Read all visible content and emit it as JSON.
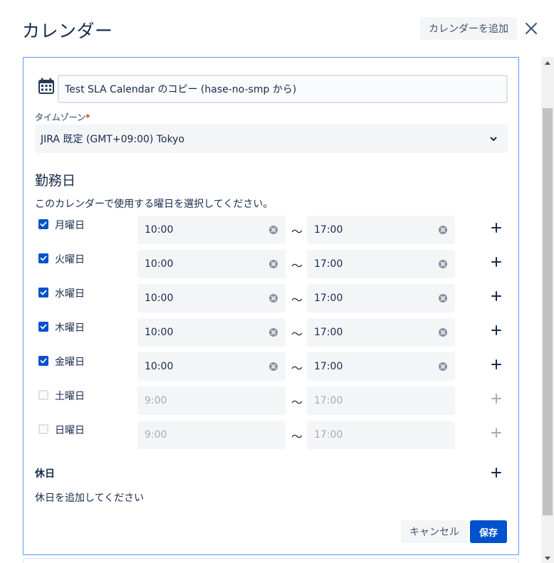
{
  "header": {
    "title": "カレンダー",
    "add_calendar_label": "カレンダーを追加",
    "close_icon": "close-icon"
  },
  "calendar": {
    "name": "Test SLA Calendar のコピー (hase-no-smp から)",
    "icon": "calendar-icon"
  },
  "timezone": {
    "label": "タイムゾーン",
    "required_mark": "*",
    "value": "JIRA 既定 (GMT+09:00) Tokyo"
  },
  "working_days": {
    "title": "勤務日",
    "description": "このカレンダーで使用する曜日を選択してください。",
    "separator": "〜",
    "days": [
      {
        "label": "月曜日",
        "checked": true,
        "start": "10:00",
        "end": "17:00"
      },
      {
        "label": "火曜日",
        "checked": true,
        "start": "10:00",
        "end": "17:00"
      },
      {
        "label": "水曜日",
        "checked": true,
        "start": "10:00",
        "end": "17:00"
      },
      {
        "label": "木曜日",
        "checked": true,
        "start": "10:00",
        "end": "17:00"
      },
      {
        "label": "金曜日",
        "checked": true,
        "start": "10:00",
        "end": "17:00"
      },
      {
        "label": "土曜日",
        "checked": false,
        "start": "9:00",
        "end": "17:00"
      },
      {
        "label": "日曜日",
        "checked": false,
        "start": "9:00",
        "end": "17:00"
      }
    ]
  },
  "holidays": {
    "title": "休日",
    "empty_text": "休日を追加してください"
  },
  "footer": {
    "cancel_label": "キャンセル",
    "save_label": "保存"
  },
  "colors": {
    "primary": "#0052cc",
    "focus_border": "#4c9aff",
    "required": "#de350b",
    "field_bg": "#f4f5f7"
  }
}
